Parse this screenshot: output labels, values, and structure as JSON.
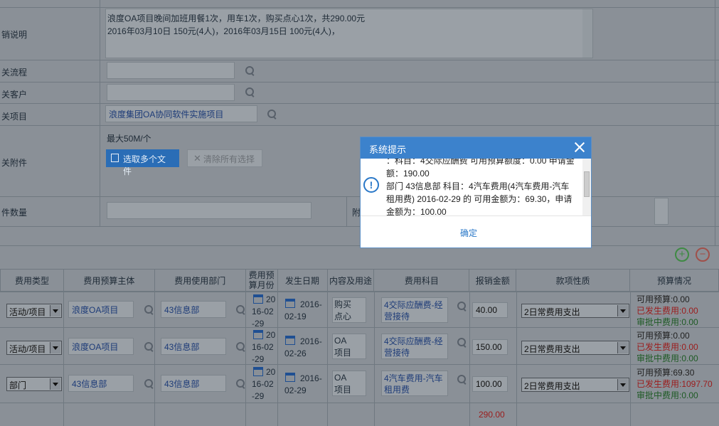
{
  "form": {
    "desc_label": "销说明",
    "desc_text_line1": "浪度OA项目晚间加班用餐1次，用车1次，购买点心1次，共290.00元",
    "desc_text_line2": "2016年03月10日 150元(4人)，2016年03月15日 100元(4人)，",
    "flow_label": "关流程",
    "customer_label": "关客户",
    "project_label": "关项目",
    "project_value": "浪度集团OA协同软件实施项目",
    "attach_label": "关附件",
    "attach_limit": "最大50M/个",
    "upload_button": "选取多个文件",
    "clear_button": "清除所有选择",
    "attach_count_label": "件数量",
    "right_label": "附"
  },
  "grid": {
    "headers": [
      "费用类型",
      "费用预算主体",
      "费用使用部门",
      "费用预算月份",
      "发生日期",
      "内容及用途",
      "费用科目",
      "报销金额",
      "款项性质",
      "预算情况"
    ],
    "rows": [
      {
        "type": "活动/项目",
        "subject": "浪度OA项目",
        "dept": "43信息部",
        "month": "2016-02-29",
        "date": "2016-02-19",
        "content": "购买点心",
        "account": "4交际应酬费-经营接待",
        "amount": "40.00",
        "nature": "2日常费用支出",
        "avail": "可用预算:0.00",
        "spent": "已发生费用:0.00",
        "pending": "审批中费用:0.00"
      },
      {
        "type": "活动/项目",
        "subject": "浪度OA项目",
        "dept": "43信息部",
        "month": "2016-02-29",
        "date": "2016-02-26",
        "content": "OA项目",
        "account": "4交际应酬费-经营接待",
        "amount": "150.00",
        "nature": "2日常费用支出",
        "avail": "可用预算:0.00",
        "spent": "已发生费用:0.00",
        "pending": "审批中费用:0.00"
      },
      {
        "type": "部门",
        "subject": "43信息部",
        "dept": "43信息部",
        "month": "2016-02-29",
        "date": "2016-02-29",
        "content": "OA项目",
        "account": "4汽车费用-汽车租用费",
        "amount": "100.00",
        "nature": "2日常费用支出",
        "avail": "可用预算:69.30",
        "spent": "已发生费用:1097.70",
        "pending": "审批中费用:0.00"
      }
    ],
    "total": "290.00"
  },
  "dialog": {
    "title": "系统提示",
    "line1": "：科目：4交际应酬费 可用预算额度：0.00 申请金",
    "line2": "额：190.00",
    "line3": "部门 43信息部 科目：4汽车费用(4汽车费用-汽车",
    "line4": "租用费) 2016-02-29 的 可用金额为：69.30，申请",
    "line5": "金额为：100.00",
    "ok": "确定"
  },
  "colors": {
    "accent": "#3c82cc",
    "overlay": "#8a9097",
    "error": "#9b1c1c",
    "ok": "#1e5a24"
  }
}
